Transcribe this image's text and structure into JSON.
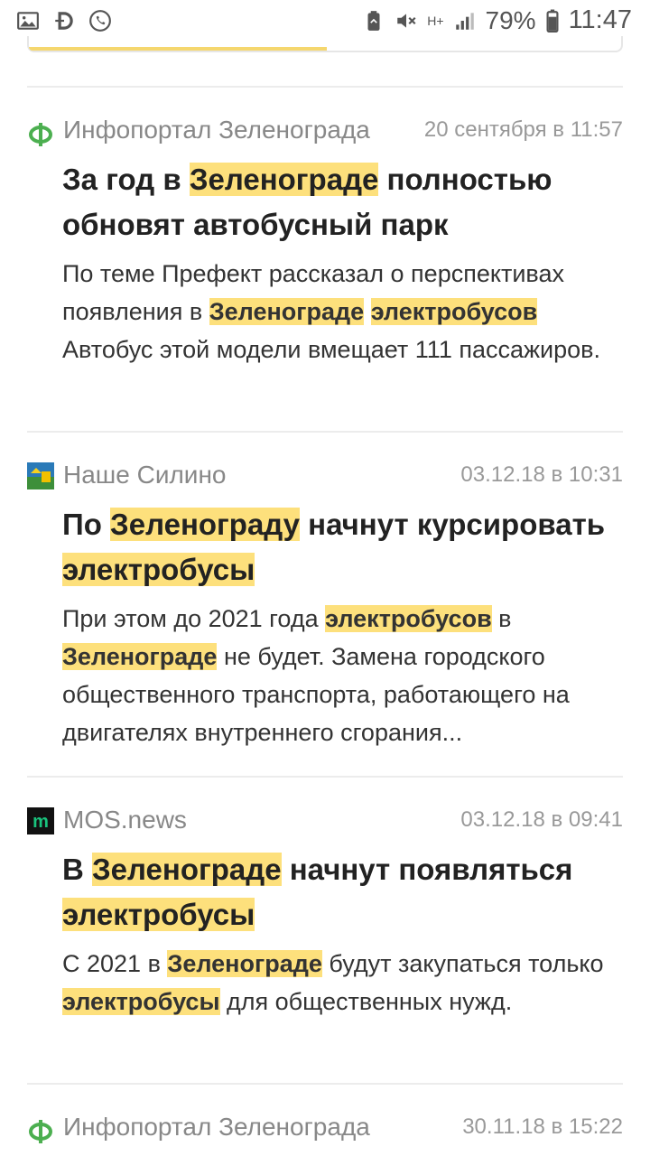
{
  "status_bar": {
    "battery": "79%",
    "time": "11:47",
    "network": "H+"
  },
  "articles": [
    {
      "source": "Инфопортал Зеленограда",
      "time": "20 сентября в 11:57",
      "title": [
        {
          "t": "За год в "
        },
        {
          "t": "Зеленограде",
          "hl": true
        },
        {
          "t": " полностью обновят автобусный парк"
        }
      ],
      "snippet": [
        {
          "t": "По теме Префект рассказал о перспективах появления в "
        },
        {
          "t": "Зеленограде",
          "hl": true
        },
        {
          "t": " "
        },
        {
          "t": "электробусов",
          "hl": true
        },
        {
          "t": " Автобус этой модели вмещает 111 пассажиров."
        }
      ]
    },
    {
      "source": "Наше Силино",
      "time": "03.12.18 в 10:31",
      "title": [
        {
          "t": "По "
        },
        {
          "t": "Зеленограду",
          "hl": true
        },
        {
          "t": " начнут курсировать "
        },
        {
          "t": "электробусы",
          "hl": true
        }
      ],
      "snippet": [
        {
          "t": "При этом до 2021 года "
        },
        {
          "t": "электробусов",
          "hl": true
        },
        {
          "t": " в "
        },
        {
          "t": "Зеленограде",
          "hl": true
        },
        {
          "t": " не будет. Замена городского общественного транспорта, работающего на двигателях внутреннего сгорания..."
        }
      ]
    },
    {
      "source": "MOS.news",
      "time": "03.12.18 в 09:41",
      "title": [
        {
          "t": "В "
        },
        {
          "t": "Зеленограде",
          "hl": true
        },
        {
          "t": " начнут появляться "
        },
        {
          "t": "электробусы",
          "hl": true
        }
      ],
      "snippet": [
        {
          "t": "С 2021 в "
        },
        {
          "t": "Зеленограде",
          "hl": true
        },
        {
          "t": " будут закупаться только "
        },
        {
          "t": "электробусы",
          "hl": true
        },
        {
          "t": " для общественных нужд."
        }
      ]
    },
    {
      "source": "Инфопортал Зеленограда",
      "time": "30.11.18 в 15:22",
      "title": [],
      "snippet": []
    }
  ],
  "logos": {
    "infoportal": "green-f-logo",
    "silino": "picture-logo",
    "mosnews": "m-logo"
  }
}
